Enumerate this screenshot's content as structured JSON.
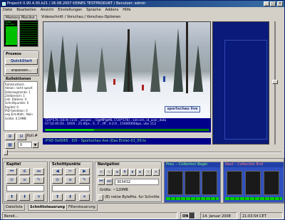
{
  "window": {
    "title": "ProjectX 0.90.4.00.b21 / 26.08.2007 KEINES TESTPRODUKT / Benutzer: admin",
    "min_label": "_",
    "max_label": "□",
    "close_label": "×"
  },
  "menu": [
    "Datei",
    "Bearbeiten",
    "Ansicht",
    "Einstellungen",
    "Sprache",
    "Addons",
    "Hilfe"
  ],
  "left": {
    "memory_header": "Memory Monitor",
    "mem_top": "29MB allocated",
    "mem_bottom": "5MB used",
    "mem_used_fraction": 0.85,
    "prozess_label": "Prozess",
    "quickstart": "QuickStart",
    "anpassen": "anpassen...",
    "kollektionen_label": "Kollektionen",
    "info_lines": [
      "Ruhezustand...",
      "Aktion: nicht spezif.",
      "Dateisegmente: 1",
      "Zeitbereich: 1",
      "inkl. Dateien: 0",
      "Schnittpunkte: 0",
      "Kapitel: 0",
      "PID-Selektion: 0",
      "exp.Ermittelt.: Nein",
      "Größe: 0.19MB"
    ],
    "kollnr_label": "Koll.#",
    "koll_value": "0"
  },
  "viewtabs": "Videoschnitt / Vorschau / Vorschau-Optionen",
  "video": {
    "banner_text": "sportschau live",
    "info_line1": "720*576 (16:9) (1/3) , unspec. , 0@MP@ML (720*576) , sim:nm, id_user_data",
    "info_line2": "07:52:45:03 , 0/0/0 , 25.0fps , S , F , tff , 4:2:0 , 15000000bps, vbv 112",
    "progress_fraction": 0.3,
    "pid_text": "(P)ID 0x0065 ; 0/0 - Sportschau live (Das Erste)-01_00.ts"
  },
  "bottom": {
    "kapitel_label": "Kapitel",
    "schnittpunkte_label": "Schnittpunkte",
    "navigation_label": "Navigation",
    "nav_field_value": "303432",
    "size_value": "Größe: ~120MB",
    "bytepos_label": "(B) netze BytePos. fur Schnitte",
    "prev_title": "Prev. – Collection Begin",
    "next_title": "Next – Collection End"
  },
  "tabs": [
    "Dateiliste",
    "Schnittsteuerung",
    "Filtersteuerung"
  ],
  "status": {
    "text": "Bereit...",
    "on": "ON",
    "date": "14. Januar 2008",
    "time": "21:03:54 CET"
  }
}
